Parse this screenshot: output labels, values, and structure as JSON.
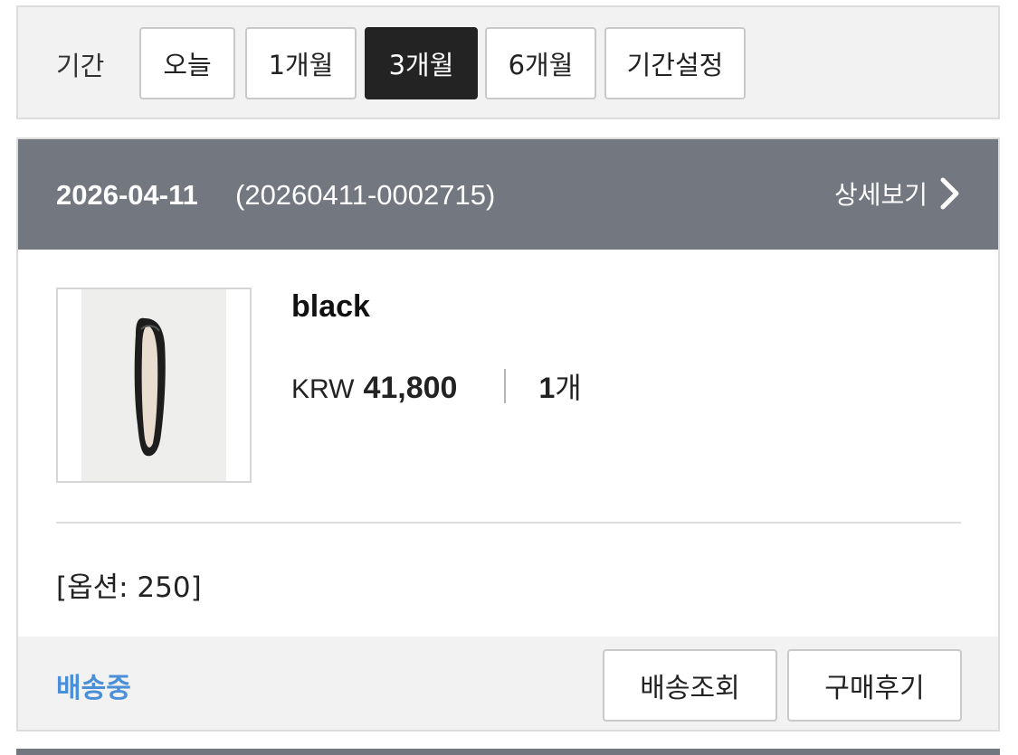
{
  "period_filter": {
    "label": "기간",
    "options": [
      "오늘",
      "1개월",
      "3개월",
      "6개월",
      "기간설정"
    ],
    "active_option": "3개월"
  },
  "order": {
    "date": "2026-04-11",
    "order_number": "(20260411-0002715)",
    "detail_link": "상세보기",
    "product": {
      "name": "black",
      "currency": "KRW",
      "price": "41,800",
      "quantity": "1",
      "quantity_unit": "개",
      "option": "[옵션: 250]"
    },
    "status": "배송중",
    "actions": {
      "track_delivery": "배송조회",
      "write_review": "구매후기"
    }
  },
  "colors": {
    "header_bg": "#737780",
    "active_tab_bg": "#232323",
    "status_blue": "#4a8fd8"
  }
}
